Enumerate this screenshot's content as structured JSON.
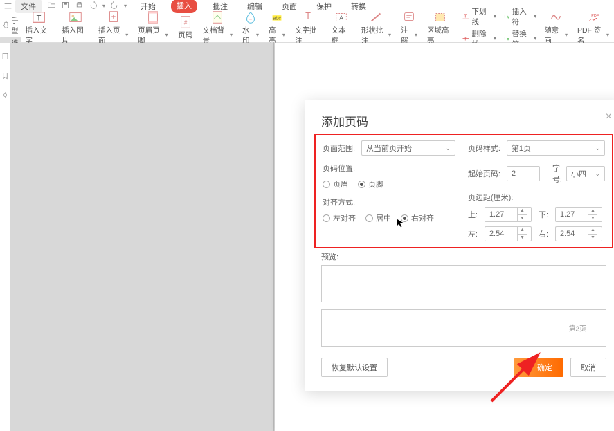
{
  "menubar": {
    "file_label": "文件",
    "tabs": [
      "开始",
      "插入",
      "批注",
      "编辑",
      "页面",
      "保护",
      "转换"
    ],
    "active_tab": "插入"
  },
  "ribbon_left": {
    "hand": "手型",
    "select": "选择"
  },
  "ribbon": [
    {
      "icon": "text",
      "label": "插入文字",
      "dd": false
    },
    {
      "icon": "image",
      "label": "插入图片",
      "dd": false
    },
    {
      "icon": "page-plus",
      "label": "插入页面",
      "dd": true
    },
    {
      "icon": "header-footer",
      "label": "页眉页脚",
      "dd": true
    },
    {
      "icon": "pagenum",
      "label": "页码",
      "dd": false
    },
    {
      "icon": "doc-bg",
      "label": "文档背景",
      "dd": true
    },
    {
      "icon": "watermark",
      "label": "水印",
      "dd": true
    },
    {
      "icon": "highlight",
      "label": "高亮",
      "dd": true
    },
    {
      "icon": "text-annot",
      "label": "文字批注",
      "dd": false
    },
    {
      "icon": "textbox",
      "label": "文本框",
      "dd": false
    },
    {
      "icon": "shape-annot",
      "label": "形状批注",
      "dd": true
    },
    {
      "icon": "note",
      "label": "注解",
      "dd": true
    },
    {
      "icon": "area-hl",
      "label": "区域高亮",
      "dd": false
    }
  ],
  "ribbon_pairs": [
    {
      "a": "下划线",
      "b": "删除线"
    },
    {
      "a": "插入符",
      "b": "替换符"
    }
  ],
  "ribbon_tail": [
    {
      "icon": "scribble",
      "label": "随意画",
      "dd": true
    },
    {
      "icon": "pdf-sign",
      "label": "PDF 签名",
      "dd": true
    }
  ],
  "dialog": {
    "title": "添加页码",
    "close": "×",
    "range_label": "页面范围:",
    "range_value": "从当前页开始",
    "style_label": "页码样式:",
    "style_value": "第1页",
    "position_label": "页码位置:",
    "pos_options": [
      "页眉",
      "页脚"
    ],
    "start_label": "起始页码:",
    "start_value": "2",
    "font_label": "字号:",
    "font_value": "小四",
    "align_label": "对齐方式:",
    "align_options": [
      "左对齐",
      "居中",
      "右对齐"
    ],
    "margin_label": "页边距(厘米):",
    "margin_top_label": "上:",
    "margin_top": "1.27",
    "margin_bottom_label": "下:",
    "margin_bottom": "1.27",
    "margin_left_label": "左:",
    "margin_left": "2.54",
    "margin_right_label": "右:",
    "margin_right": "2.54",
    "preview_label": "预览:",
    "preview_page2": "第2页",
    "reset_btn": "恢复默认设置",
    "ok_btn": "确定",
    "cancel_btn": "取消"
  }
}
